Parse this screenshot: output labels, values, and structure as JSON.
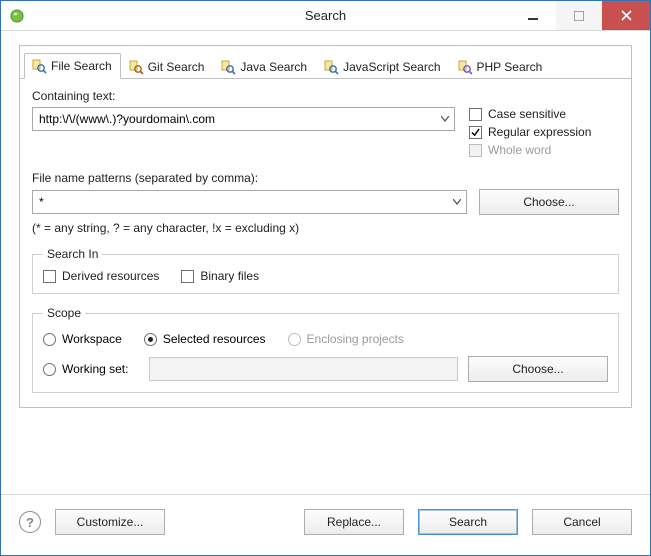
{
  "window": {
    "title": "Search"
  },
  "tabs": [
    {
      "label": "File Search"
    },
    {
      "label": "Git Search"
    },
    {
      "label": "Java Search"
    },
    {
      "label": "JavaScript Search"
    },
    {
      "label": "PHP Search"
    }
  ],
  "containing": {
    "label": "Containing text:",
    "value": "http:\\/\\/(www\\.)?yourdomain\\.com"
  },
  "options": {
    "case_sensitive_label": "Case sensitive",
    "regex_label": "Regular expression",
    "whole_word_label": "Whole word"
  },
  "patterns": {
    "label": "File name patterns (separated by comma):",
    "value": "*",
    "choose_label": "Choose...",
    "hint": "(* = any string, ? = any character, !x = excluding x)"
  },
  "search_in": {
    "legend": "Search In",
    "derived_label": "Derived resources",
    "binary_label": "Binary files"
  },
  "scope": {
    "legend": "Scope",
    "workspace_label": "Workspace",
    "selected_label": "Selected resources",
    "enclosing_label": "Enclosing projects",
    "working_set_label": "Working set:",
    "choose_label": "Choose..."
  },
  "footer": {
    "customize_label": "Customize...",
    "replace_label": "Replace...",
    "search_label": "Search",
    "cancel_label": "Cancel"
  }
}
